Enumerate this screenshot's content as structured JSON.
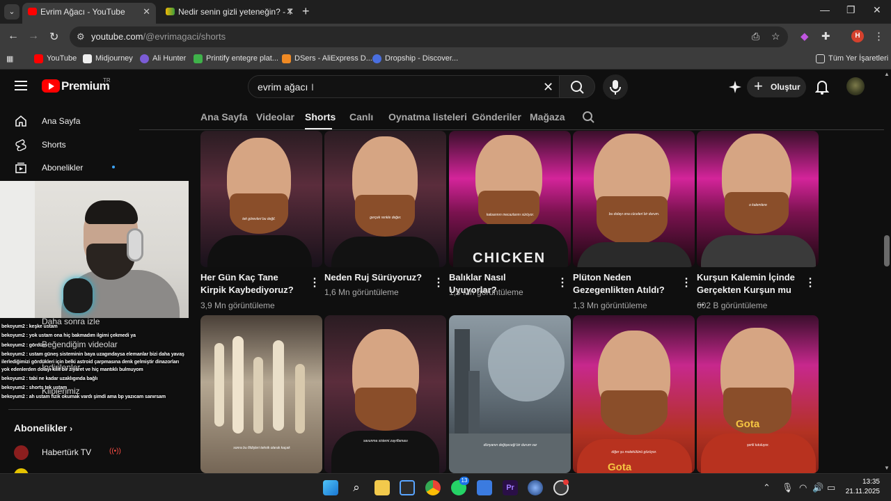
{
  "browser": {
    "tabs": [
      {
        "title": "Evrim Ağacı - YouTube",
        "active": true
      },
      {
        "title": "Nedir senin gizli yeteneğin? - T",
        "active": false
      }
    ],
    "url_host": "youtube.com",
    "url_path": "/@evrimagaci/shorts",
    "profile_initial": "H",
    "bookmarks": [
      "YouTube",
      "Midjourney",
      "Ali Hunter",
      "Printify entegre plat...",
      "DSers - AliExpress D...",
      "Dropship - Discover..."
    ],
    "all_bookmarks": "Tüm Yer İşaretleri"
  },
  "header": {
    "logo": "Premium",
    "logo_sup": "TR",
    "search_value": "evrim ağacı",
    "create_label": "Oluştur"
  },
  "sidebar": {
    "items": [
      {
        "label": "Ana Sayfa"
      },
      {
        "label": "Shorts"
      },
      {
        "label": "Abonelikler"
      }
    ],
    "hidden_items": [
      "Daha sonra izle",
      "Beğendiğim videolar",
      "İndirilenler",
      "Kliplerimiz"
    ],
    "subscriptions_header": "Abonelikler",
    "channels": [
      "Habertürk TV",
      "idle..."
    ]
  },
  "overlay_chat": [
    "bekoyum2 : keşke ustam",
    "bekoyum2 : yok ustam ona hiç bakmadım ilgimi çekmedi ya",
    "bekoyum2 : gördüm",
    "bekoyum2 : ustam güneş sisteminin baya uzagındaysa elemanlar bizi daha yavaş",
    "ilerlediğimizi gördükleri için belki astroid çarpmasına denk gelmiştir dinazorları",
    "yok edenlerden dolayı kilit bir ziyaret ve hiç mantıklı bulmuyom",
    "bekoyum2 : tabi ne kadar uzaklıgında bağlı",
    "bekoyum2 : shorts tek ustam",
    "bekoyum2 : ah ustam fizik okumak vardı şimdi ama bp yazıcam sanırsam"
  ],
  "channel_tabs": [
    "Ana Sayfa",
    "Videolar",
    "Shorts",
    "Canlı",
    "Oynatma listeleri",
    "Gönderiler",
    "Mağaza"
  ],
  "shorts": [
    {
      "title": "Her Gün Kaç Tane Kirpik Kaybediyoruz?",
      "views": "3,9 Mn görüntüleme",
      "caption": "tek görevleri bu değil."
    },
    {
      "title": "Neden Ruj Sürüyoruz?",
      "views": "1,6 Mn görüntüleme",
      "caption": "gerçek renkle değer."
    },
    {
      "title": "Balıklar Nasıl Uyuyorlar?",
      "views": "1,5 Mn görüntüleme",
      "caption": "kaloarının mecazlarını sürüyor."
    },
    {
      "title": "Plüton Neden Gezegenlikten Atıldı?",
      "views": "1,3 Mn görüntüleme",
      "caption": "bu dolayı ona cüceleri bir durum."
    },
    {
      "title": "Kurşun Kalemin İçinde Gerçekten Kurşun mu ...",
      "views": "602 B görüntüleme",
      "caption": "o kalemlere"
    },
    {
      "title": "",
      "views": "",
      "caption": "sonra bu fildişleri teknik olarak kaçak"
    },
    {
      "title": "",
      "views": "",
      "caption": "savunma sistemi zayıflaması"
    },
    {
      "title": "",
      "views": "",
      "caption": "dünyanın değişeceği bir durum var"
    },
    {
      "title": "",
      "views": "",
      "caption": "diğer şu molekülünü gözüyor."
    },
    {
      "title": "",
      "views": "",
      "caption": "şerili tutuluyor."
    }
  ],
  "taskbar": {
    "time": "13:35",
    "date": "21.11.2025",
    "whatsapp_badge": "13"
  },
  "colors": {
    "accent": "#ff0000",
    "link": "#3ea6ff"
  }
}
